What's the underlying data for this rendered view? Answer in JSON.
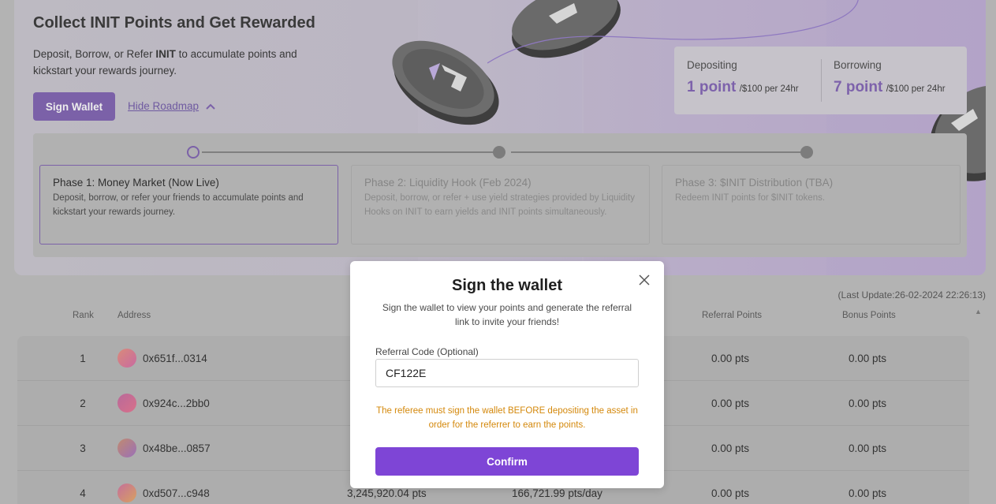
{
  "banner": {
    "title": "Collect INIT Points and Get Rewarded",
    "subtitle_before": "Deposit, Borrow, or Refer ",
    "subtitle_bold": "INIT",
    "subtitle_after": " to accumulate points and kickstart your rewards journey.",
    "sign_wallet_label": "Sign Wallet",
    "roadmap_toggle_label": "Hide Roadmap",
    "coin_icon": "init-coin-icon",
    "chevron_icon": "chevron-up-icon"
  },
  "stats": {
    "depositing": {
      "label": "Depositing",
      "value": "1 point",
      "unit": "/$100 per 24hr"
    },
    "borrowing": {
      "label": "Borrowing",
      "value": "7 point",
      "unit": "/$100 per 24hr"
    }
  },
  "roadmap": {
    "phases": [
      {
        "title": "Phase 1: Money Market (Now Live)",
        "desc": "Deposit, borrow, or refer your friends to accumulate points and kickstart your rewards journey.",
        "active": true
      },
      {
        "title": "Phase 2: Liquidity Hook (Feb 2024)",
        "desc": "Deposit, borrow, or refer + use yield strategies provided by Liquidity Hooks on INIT to earn yields and INIT points simultaneously.",
        "active": false
      },
      {
        "title": "Phase 3: $INIT Distribution (TBA)",
        "desc": "Redeem INIT points for $INIT tokens.",
        "active": false
      }
    ]
  },
  "leaderboard": {
    "last_update": "(Last Update:26-02-2024 22:26:13)",
    "columns": {
      "rank": "Rank",
      "address": "Address",
      "referral": "Referral Points",
      "bonus": "Bonus Points"
    },
    "rows": [
      {
        "rank": "1",
        "address": "0x651f...0314",
        "total": "",
        "daily": "",
        "referral": "0.00 pts",
        "bonus": "0.00 pts"
      },
      {
        "rank": "2",
        "address": "0x924c...2bb0",
        "total": "",
        "daily": "",
        "referral": "0.00 pts",
        "bonus": "0.00 pts"
      },
      {
        "rank": "3",
        "address": "0x48be...0857",
        "total": "",
        "daily": "",
        "referral": "0.00 pts",
        "bonus": "0.00 pts"
      },
      {
        "rank": "4",
        "address": "0xd507...c948",
        "total": "3,245,920.04 pts",
        "daily": "166,721.99 pts/day",
        "referral": "0.00 pts",
        "bonus": "0.00 pts"
      }
    ],
    "avatar_colors": [
      [
        "#d98a7a",
        "#c86aa0"
      ],
      [
        "#b86a9a",
        "#d8708a"
      ],
      [
        "#c08a70",
        "#9a70b8"
      ],
      [
        "#c4709a",
        "#d8a060"
      ]
    ]
  },
  "modal": {
    "title": "Sign the wallet",
    "description": "Sign the wallet to view your points and generate the referral link to invite your friends!",
    "referral_label": "Referral Code (Optional)",
    "referral_value": "CF122E",
    "warning": "The referee must sign the wallet BEFORE depositing the asset in order for the referrer to earn the points.",
    "confirm_label": "Confirm",
    "close_icon": "close-icon"
  },
  "colors": {
    "accent": "#7e45d6",
    "warning": "#d4880b",
    "overlay_dim_accent": "#7b61a8"
  }
}
